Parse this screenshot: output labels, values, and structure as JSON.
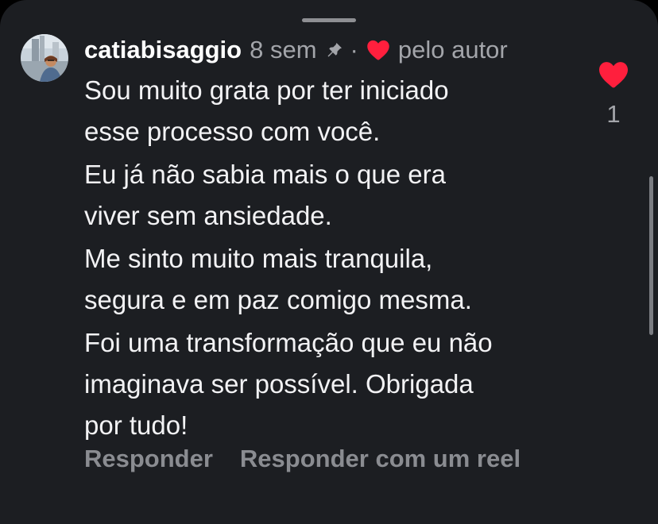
{
  "comment": {
    "username": "catiabisaggio",
    "time": "8 sem",
    "separator": "·",
    "author_like_label": "pelo autor",
    "paragraphs": [
      [
        "Sou muito grata por ter iniciado",
        "esse processo com você."
      ],
      [
        "Eu já não sabia mais o que era",
        "viver sem ansiedade."
      ],
      [
        "Me sinto muito mais tranquila,",
        "segura e em paz comigo mesma."
      ],
      [
        "Foi uma transformação que eu não",
        "imaginava ser possível. Obrigada",
        "por tudo!"
      ]
    ],
    "like_count": "1"
  },
  "actions": {
    "reply_label": "Responder",
    "reply_reel_label": "Responder com um reel"
  },
  "icons": {
    "pin": "pin-icon",
    "author_heart": "heart-filled-icon",
    "like": "heart-filled-icon"
  },
  "colors": {
    "background": "#1c1e22",
    "text_primary": "#f2f2f4",
    "text_secondary": "#a3a5aa",
    "heart": "#ff1f3d"
  }
}
